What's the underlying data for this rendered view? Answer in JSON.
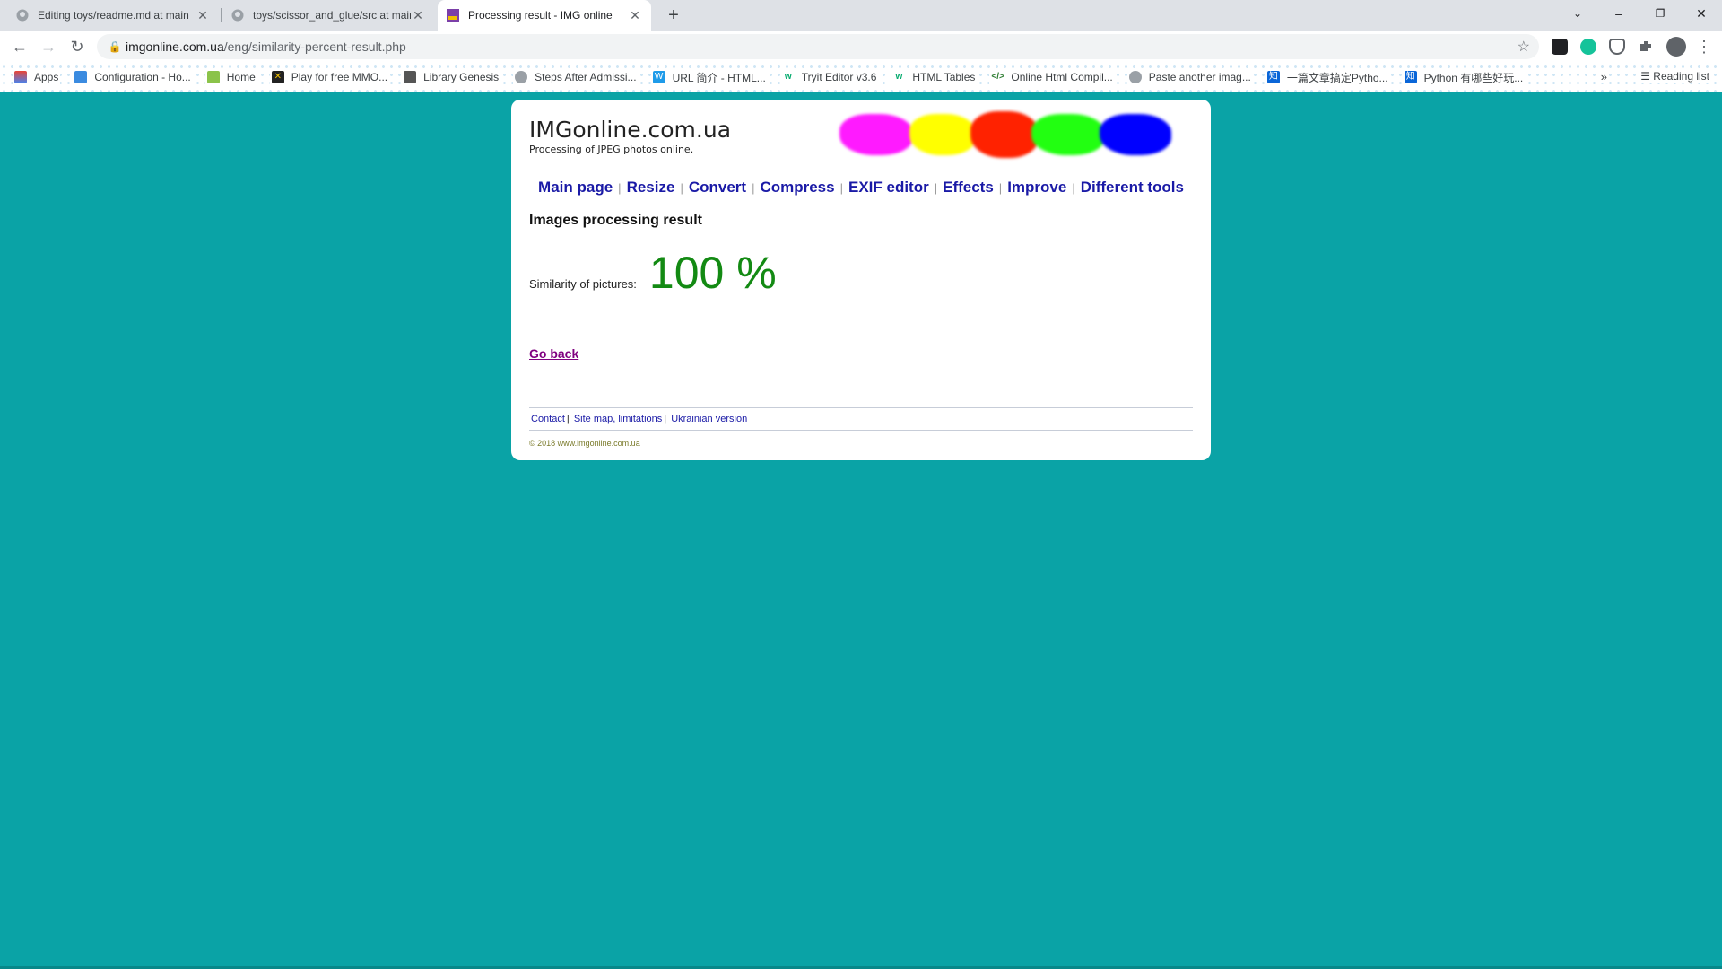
{
  "browser": {
    "tabs": [
      {
        "title": "Editing toys/readme.md at main",
        "active": false
      },
      {
        "title": "toys/scissor_and_glue/src at main",
        "active": false
      },
      {
        "title": "Processing result - IMG online",
        "active": true
      }
    ],
    "address": {
      "host": "imgonline.com.ua",
      "path": "/eng/similarity-percent-result.php"
    },
    "bookmarks": [
      "Apps",
      "Configuration - Ho...",
      "Home",
      "Play for free MMO...",
      "Library Genesis",
      "Steps After Admissi...",
      "URL 简介 - HTML...",
      "Tryit Editor v3.6",
      "HTML Tables",
      "Online Html Compil...",
      "Paste another imag...",
      "一篇文章搞定Pytho...",
      "Python 有哪些好玩..."
    ],
    "reading_list": "Reading list"
  },
  "site": {
    "name": "IMGonline.com.ua",
    "tagline": "Processing of JPEG photos online.",
    "blob_colors": [
      "#ff1aff",
      "#ffff00",
      "#ff2200",
      "#22ff11",
      "#0000ff"
    ],
    "menu": [
      "Main page",
      "Resize",
      "Convert",
      "Compress",
      "EXIF editor",
      "Effects",
      "Improve",
      "Different tools"
    ]
  },
  "result": {
    "heading": "Images processing result",
    "similarity_label": "Similarity of pictures:",
    "similarity_value": "100 %",
    "go_back": "Go back"
  },
  "footer": {
    "contact": "Contact",
    "sitemap": "Site map, limitations",
    "ukrainian": "Ukrainian version",
    "copyright": "© 2018 www.imgonline.com.ua"
  }
}
